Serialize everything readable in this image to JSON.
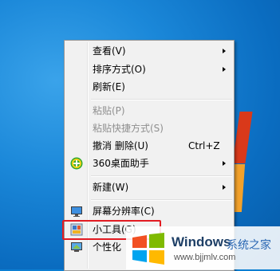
{
  "menu": {
    "items": [
      {
        "label": "查看(V)",
        "submenu": true
      },
      {
        "label": "排序方式(O)",
        "submenu": true
      },
      {
        "label": "刷新(E)"
      },
      {
        "label": "粘贴(P)",
        "disabled": true
      },
      {
        "label": "粘贴快捷方式(S)",
        "disabled": true
      },
      {
        "label": "撤消 删除(U)",
        "shortcut": "Ctrl+Z"
      },
      {
        "label": "360桌面助手",
        "submenu": true,
        "icon": "360-icon"
      },
      {
        "label": "新建(W)",
        "submenu": true
      },
      {
        "label": "屏幕分辨率(C)",
        "icon": "monitor-icon"
      },
      {
        "label": "小工具(G)",
        "icon": "gadgets-icon"
      },
      {
        "label": "个性化",
        "icon": "personalize-icon"
      }
    ]
  },
  "watermark": {
    "title": "Windows",
    "title2": "系统之家",
    "url": "www.bjjmlv.com"
  },
  "colors": {
    "desktop": "#0b7fd3",
    "highlight_border": "#e21b22",
    "menu_bg": "#f1f1f1"
  }
}
